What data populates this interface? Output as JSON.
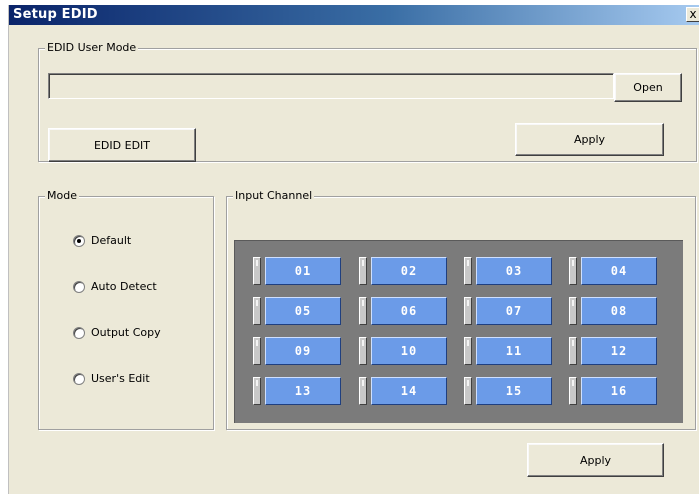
{
  "window": {
    "title": "Setup EDID",
    "close_label": "x"
  },
  "user_mode": {
    "group_label": "EDID User Mode",
    "path_value": "",
    "open_label": "Open",
    "edit_label": "EDID EDIT",
    "apply_label": "Apply"
  },
  "mode": {
    "group_label": "Mode",
    "options": [
      {
        "label": "Default",
        "checked": true
      },
      {
        "label": "Auto Detect",
        "checked": false
      },
      {
        "label": "Output Copy",
        "checked": false
      },
      {
        "label": "User's Edit",
        "checked": false
      }
    ]
  },
  "input_channel": {
    "group_label": "Input Channel",
    "channels": [
      "01",
      "02",
      "03",
      "04",
      "05",
      "06",
      "07",
      "08",
      "09",
      "10",
      "11",
      "12",
      "13",
      "14",
      "15",
      "16"
    ],
    "button_color": "#6b9be8",
    "panel_color": "#7b7b7b"
  },
  "footer": {
    "apply_label": "Apply"
  }
}
